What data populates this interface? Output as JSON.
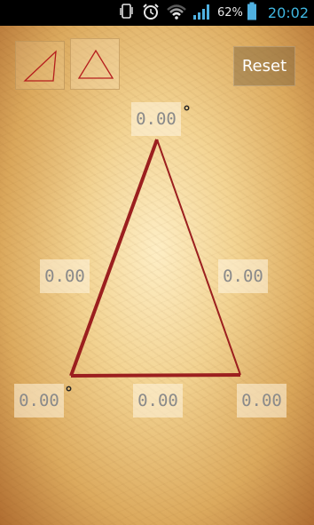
{
  "status_bar": {
    "battery_percent": "62%",
    "time": "20:02",
    "icons": [
      "phone-rotate-icon",
      "alarm-icon",
      "wifi-icon",
      "signal-icon",
      "battery-icon"
    ],
    "clock_color": "#3fb6e0"
  },
  "toolbar": {
    "reset_label": "Reset",
    "shape_buttons": [
      "right-triangle-icon",
      "isosceles-triangle-icon"
    ]
  },
  "triangle": {
    "color": "#9b1f1f",
    "angle_top": "0.00",
    "angle_bottom_left": "0.00",
    "side_left": "0.00",
    "side_right": "0.00",
    "side_bottom": "0.00",
    "angle_bottom_right": "0.00",
    "degree_symbol": "°"
  }
}
